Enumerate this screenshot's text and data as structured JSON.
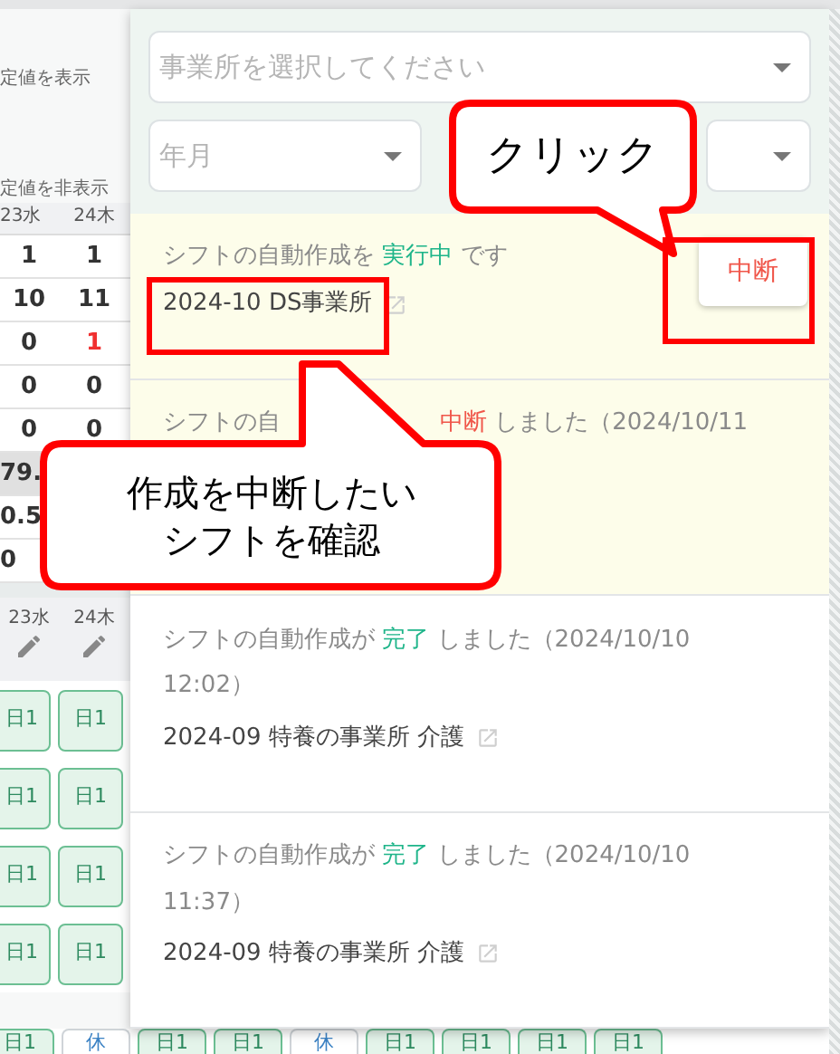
{
  "background": {
    "labels": [
      "定値を表示",
      "定値を非表示"
    ],
    "table_header": [
      "23水",
      "24木"
    ],
    "table_rows": [
      {
        "kind": "plain",
        "cells": [
          {
            "text": "1",
            "alert": false
          },
          {
            "text": "1",
            "alert": false
          }
        ]
      },
      {
        "kind": "plain",
        "cells": [
          {
            "text": "10",
            "alert": false
          },
          {
            "text": "11",
            "alert": false
          }
        ]
      },
      {
        "kind": "plain",
        "cells": [
          {
            "text": "0",
            "alert": false
          },
          {
            "text": "1",
            "alert": true
          }
        ]
      },
      {
        "kind": "plain",
        "cells": [
          {
            "text": "0",
            "alert": false
          },
          {
            "text": "0",
            "alert": false
          }
        ]
      },
      {
        "kind": "plain",
        "cells": [
          {
            "text": "0",
            "alert": false
          },
          {
            "text": "0",
            "alert": false
          }
        ]
      },
      {
        "kind": "shaded",
        "cells": [
          {
            "text": "79.",
            "alert": false
          }
        ]
      },
      {
        "kind": "plain",
        "cells": [
          {
            "text": "0.5",
            "alert": false
          }
        ]
      },
      {
        "kind": "plain",
        "cells": [
          {
            "text": "0",
            "alert": false
          }
        ]
      }
    ],
    "shift_header": [
      "23水",
      "24木"
    ],
    "shift_rows": [
      [
        {
          "kind": "work",
          "text": "日1"
        },
        {
          "kind": "work",
          "text": "日1"
        }
      ],
      [
        {
          "kind": "work",
          "text": "日1"
        },
        {
          "kind": "work",
          "text": "日1"
        }
      ],
      [
        {
          "kind": "work",
          "text": "日1"
        },
        {
          "kind": "work",
          "text": "日1"
        }
      ],
      [
        {
          "kind": "work",
          "text": "日1"
        },
        {
          "kind": "work",
          "text": "日1"
        }
      ]
    ],
    "bottom_row": [
      {
        "kind": "work",
        "text": "日1"
      },
      {
        "kind": "off",
        "text": "休"
      },
      {
        "kind": "work",
        "text": "日1"
      },
      {
        "kind": "work",
        "text": "日1"
      },
      {
        "kind": "off",
        "text": "休"
      },
      {
        "kind": "work",
        "text": "日1"
      },
      {
        "kind": "work",
        "text": "日1"
      },
      {
        "kind": "work",
        "text": "日1"
      },
      {
        "kind": "work",
        "text": "日1"
      }
    ]
  },
  "panel": {
    "office_select": {
      "placeholder": "事業所を選択してください"
    },
    "month_select": {
      "placeholder": "年月"
    },
    "jobs": [
      {
        "kind": "running",
        "segments": [
          {
            "kind": "plain",
            "text": "シフトの自動作成を"
          },
          {
            "kind": "status",
            "text": "実行中"
          },
          {
            "kind": "plain",
            "text": "です"
          }
        ],
        "target": "2024-10 DS事業所",
        "button": "中断"
      },
      {
        "kind": "stopped",
        "segments": [
          {
            "kind": "plain",
            "text": "シフトの自"
          },
          {
            "kind": "gap"
          },
          {
            "kind": "status",
            "text": "中断"
          },
          {
            "kind": "plain",
            "text": "しました（2024/10/11"
          }
        ]
      },
      {
        "kind": "done",
        "segments": [
          {
            "kind": "plain",
            "text": "シフトの自動作成が"
          },
          {
            "kind": "status",
            "text": "完了"
          },
          {
            "kind": "plain",
            "text": "しました（2024/10/10"
          }
        ],
        "time": "12:02）",
        "target": "2024-09 特養の事業所 介護"
      },
      {
        "kind": "done",
        "segments": [
          {
            "kind": "plain",
            "text": "シフトの自動作成が"
          },
          {
            "kind": "status",
            "text": "完了"
          },
          {
            "kind": "plain",
            "text": "しました（2024/10/10"
          }
        ],
        "time": "11:37）",
        "target": "2024-09 特養の事業所 介護"
      }
    ]
  },
  "annotations": [
    {
      "kind": "callout_click",
      "lines": [
        "クリック"
      ]
    },
    {
      "kind": "callout_confirm",
      "lines": [
        "作成を中断したい",
        "シフトを確認"
      ]
    },
    {
      "kind": "frame_target"
    },
    {
      "kind": "frame_button"
    }
  ]
}
